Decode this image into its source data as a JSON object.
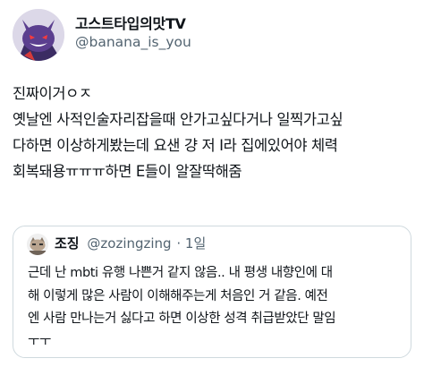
{
  "author": {
    "display_name": "고스트타입의맛TV",
    "handle": "@banana_is_you"
  },
  "tweet": {
    "lines": [
      "진짜이거ㅇㅈ",
      "옛날엔 사적인술자리잡을때 안가고싶다거나 일찍가고싶",
      "다하면 이상하게봤는데 요샌 걍 저 I라 집에있어야 체력",
      "회복돼용ㅠㅠㅠ하면 E들이 알잘딱해줌"
    ]
  },
  "quote": {
    "name": "조징",
    "handle": "@zozingzing",
    "time": "· 1일",
    "lines": [
      "근데 난 mbti 유행 나쁜거 같지 않음.. 내 평생 내향인에 대",
      "해 이렇게 많은 사람이 이해해주는게 처음인 거 같음. 예전",
      "엔 사람 만나는거 싫다고 하면 이상한 성격 취급받았단 말임",
      "ㅜㅜ"
    ]
  }
}
